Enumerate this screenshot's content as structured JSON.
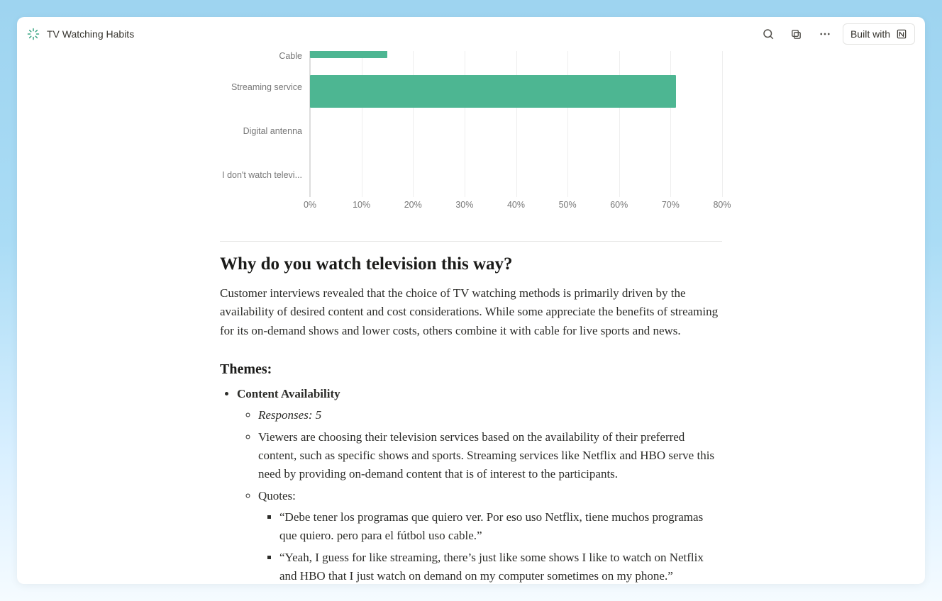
{
  "header": {
    "title": "TV Watching Habits",
    "built_with_label": "Built with"
  },
  "chart_data": {
    "type": "bar",
    "orientation": "horizontal",
    "categories": [
      "Cable",
      "Streaming service",
      "Digital antenna",
      "I don't watch televi..."
    ],
    "values": [
      15,
      71,
      0,
      0
    ],
    "xlim": [
      0,
      80
    ],
    "xticks": [
      "0%",
      "10%",
      "20%",
      "30%",
      "40%",
      "50%",
      "60%",
      "70%",
      "80%"
    ],
    "bar_color": "#4db692",
    "title": "",
    "ylabel": "",
    "xlabel": ""
  },
  "section": {
    "heading": "Why do you watch television this way?",
    "body": "Customer interviews revealed that the choice of TV watching methods is primarily driven by the availability of desired content and cost considerations. While some appreciate the benefits of streaming for its on-demand shows and lower costs, others combine it with cable for live sports and news.",
    "themes_heading": "Themes:",
    "themes": [
      {
        "name": "Content Availability",
        "responses_label": "Responses: 5",
        "summary": "Viewers are choosing their television services based on the availability of their preferred content, such as specific shows and sports. Streaming services like Netflix and HBO serve this need by providing on-demand content that is of interest to the participants.",
        "quotes_label": "Quotes:",
        "quotes": [
          "“Debe tener los programas que quiero ver. Por eso uso Netflix, tiene muchos programas que quiero. pero para el fútbol uso cable.”",
          "“Yeah, I guess for like streaming, there’s just like some shows I like to watch on Netflix and HBO that I just watch on demand on my computer sometimes on my phone.”"
        ]
      }
    ]
  }
}
